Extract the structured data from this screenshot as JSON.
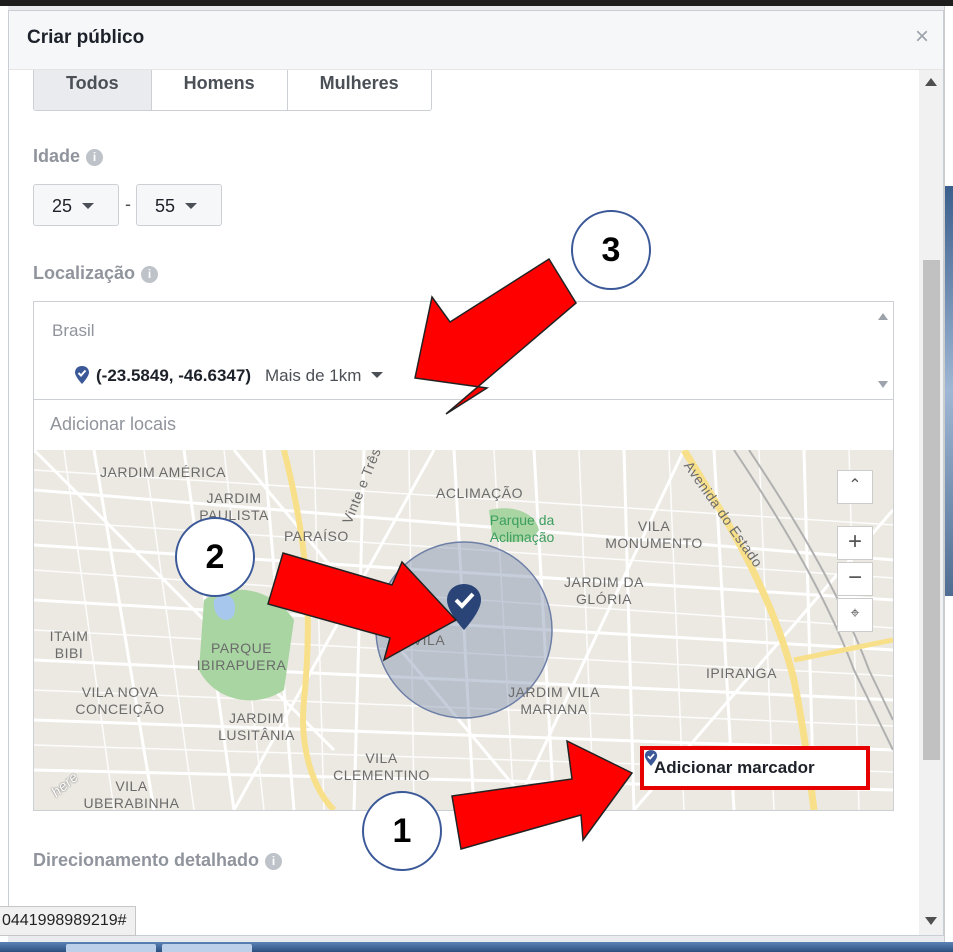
{
  "window": {
    "status_url": "0441998989219#"
  },
  "dialog": {
    "title": "Criar público",
    "close": "×",
    "gender": {
      "options": [
        "Todos",
        "Homens",
        "Mulheres"
      ],
      "selected": "Todos"
    },
    "age": {
      "label": "Idade",
      "min": "25",
      "separator": "-",
      "max": "55"
    },
    "location": {
      "label": "Localização",
      "country": "Brasil",
      "pin_coords": "(-23.5849, -46.6347)",
      "radius": "Mais de 1km",
      "add_placeholder": "Adicionar locais"
    },
    "map": {
      "labels": [
        "JARDIM AMÉRICA",
        "JARDIM PAULISTA",
        "PARAÍSO",
        "ACLIMAÇÃO",
        "Parque da Aclimação",
        "VILA MONUMENTO",
        "JARDIM DA GLÓRIA",
        "ITAIM BIBI",
        "PARQUE IBIRAPUERA",
        "VILA MARIANA",
        "IPIRANGA",
        "VILA NOVA CONCEIÇÃO",
        "JARDIM VILA MARIANA",
        "JARDIM LUSITÂNIA",
        "VILA CLEMENTINO",
        "VILA UBERABINHA",
        "Vinte e Três de",
        "Avenida do Estado",
        "here"
      ],
      "zoom_in": "+",
      "zoom_out": "−",
      "add_marker": "Adicionar marcador"
    },
    "detailed": {
      "label": "Direcionamento detalhado"
    }
  },
  "annotations": {
    "badges": [
      "1",
      "2",
      "3"
    ],
    "arrow_color": "#ff0000",
    "highlight_color": "#e60000"
  },
  "colors": {
    "accent": "#3b5998",
    "map_bg": "#ece9e2",
    "park": "#a8d5a2",
    "water": "#a7c8ec"
  }
}
